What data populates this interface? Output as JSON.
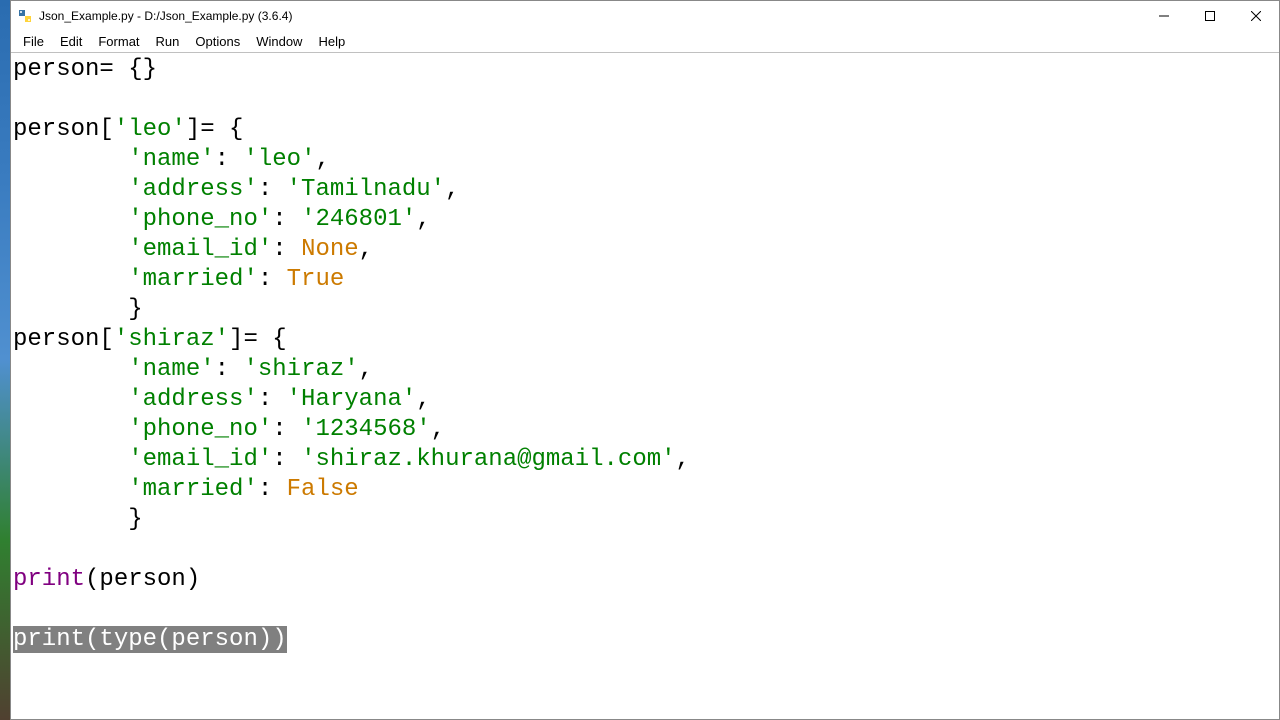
{
  "window": {
    "title": "Json_Example.py - D:/Json_Example.py (3.6.4)"
  },
  "menus": {
    "file": "File",
    "edit": "Edit",
    "format": "Format",
    "run": "Run",
    "options": "Options",
    "window": "Window",
    "help": "Help"
  },
  "code": {
    "l1a": "person= {}",
    "l2": "",
    "l3a": "person[",
    "l3b": "'leo'",
    "l3c": "]= {",
    "l4a": "        ",
    "l4b": "'name'",
    "l4c": ": ",
    "l4d": "'leo'",
    "l4e": ",",
    "l5a": "        ",
    "l5b": "'address'",
    "l5c": ": ",
    "l5d": "'Tamilnadu'",
    "l5e": ",",
    "l6a": "        ",
    "l6b": "'phone_no'",
    "l6c": ": ",
    "l6d": "'246801'",
    "l6e": ",",
    "l7a": "        ",
    "l7b": "'email_id'",
    "l7c": ": ",
    "l7d": "None",
    "l7e": ",",
    "l8a": "        ",
    "l8b": "'married'",
    "l8c": ": ",
    "l8d": "True",
    "l9a": "        }",
    "l10a": "person[",
    "l10b": "'shiraz'",
    "l10c": "]= {",
    "l11a": "        ",
    "l11b": "'name'",
    "l11c": ": ",
    "l11d": "'shiraz'",
    "l11e": ",",
    "l12a": "        ",
    "l12b": "'address'",
    "l12c": ": ",
    "l12d": "'Haryana'",
    "l12e": ",",
    "l13a": "        ",
    "l13b": "'phone_no'",
    "l13c": ": ",
    "l13d": "'1234568'",
    "l13e": ",",
    "l14a": "        ",
    "l14b": "'email_id'",
    "l14c": ": ",
    "l14d": "'shiraz.khurana@gmail.com'",
    "l14e": ",",
    "l15a": "        ",
    "l15b": "'married'",
    "l15c": ": ",
    "l15d": "False",
    "l16a": "        }",
    "l17": "",
    "l18a": "print",
    "l18b": "(person)",
    "l19": "",
    "l20a": "print",
    "l20b": "(",
    "l20c": "type",
    "l20d": "(person))"
  }
}
